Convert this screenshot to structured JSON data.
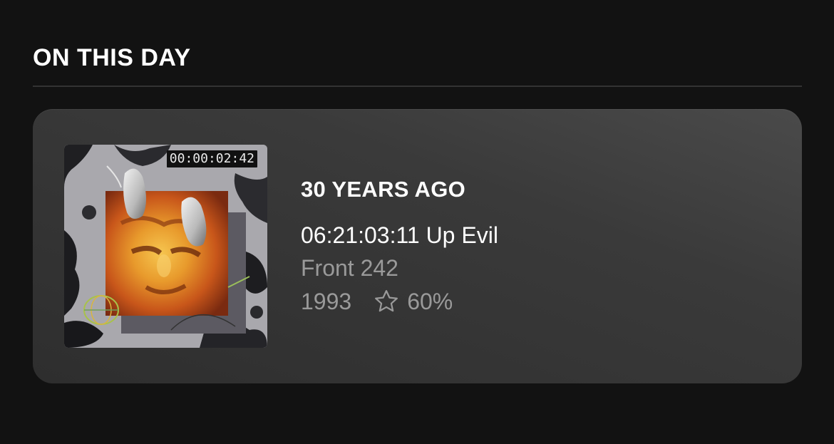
{
  "section": {
    "title": "ON THIS DAY"
  },
  "card": {
    "years_ago": "30 YEARS AGO",
    "track_title": "06:21:03:11 Up Evil",
    "artist": "Front 242",
    "year": "1993",
    "rating": "60%",
    "rating_icon": "star-outline-icon",
    "cover": {
      "timecode": "00:00:02:42"
    }
  }
}
